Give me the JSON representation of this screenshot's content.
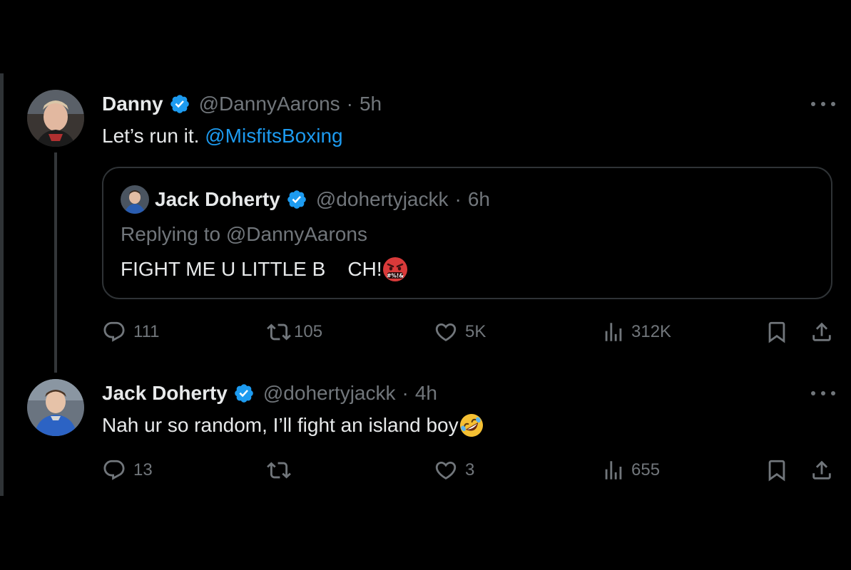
{
  "thread": {
    "tweet1": {
      "display_name": "Danny",
      "handle": "@DannyAarons",
      "dot": "·",
      "time": "5h",
      "text_prefix": "Let’s run it. ",
      "mention": "@MisfitsBoxing",
      "quote": {
        "display_name": "Jack Doherty",
        "handle": "@dohertyjackk",
        "dot": "·",
        "time": "6h",
        "replying_to": "Replying to @DannyAarons",
        "text": "FIGHT ME U LITTLE B    CH!"
      },
      "actions": {
        "replies": "111",
        "reposts": "105",
        "likes": "5K",
        "views": "312K"
      }
    },
    "tweet2": {
      "display_name": "Jack Doherty",
      "handle": "@dohertyjackk",
      "dot": "·",
      "time": "4h",
      "text": "Nah ur so random, I’ll fight an island boy",
      "actions": {
        "replies": "13",
        "reposts": "",
        "likes": "3",
        "views": "655"
      }
    }
  },
  "colors": {
    "background": "#000000",
    "text": "#e7e9ea",
    "muted": "#71767b",
    "accent": "#1d9bf0",
    "border": "#2f3336"
  },
  "icons": {
    "verified": "verified-badge-icon",
    "reply": "reply-icon",
    "repost": "repost-icon",
    "like": "heart-icon",
    "views": "views-icon",
    "bookmark": "bookmark-icon",
    "share": "share-icon",
    "more": "more-icon",
    "emoji_angry": "angry-face-emoji",
    "emoji_laugh": "rolling-laughing-emoji"
  }
}
